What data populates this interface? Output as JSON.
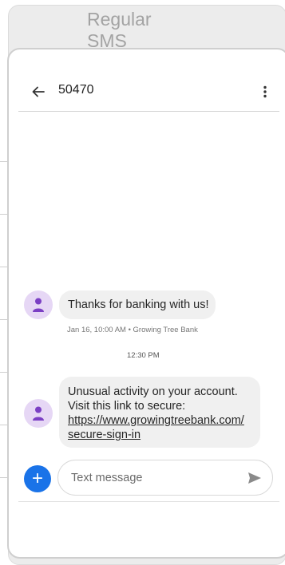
{
  "section_title": "Regular SMS",
  "header": {
    "contact": "50470",
    "back_icon": "arrow-left-icon",
    "more_icon": "more-vertical-icon"
  },
  "messages": [
    {
      "text": "Thanks for banking with us!",
      "meta": "Jan 16, 10:00 AM • Growing Tree Bank"
    },
    {
      "time_separator": "12:30 PM",
      "line1": "Unusual activity on your account.",
      "line2": "Visit this link to secure:",
      "link1": "https://www.growingtreebank.com/",
      "link2": "secure-sign-in"
    }
  ],
  "composer": {
    "placeholder": "Text message",
    "add_icon": "plus-icon",
    "add_label": "+",
    "send_icon": "send-icon"
  },
  "colors": {
    "accent": "#1a73e8",
    "avatar_bg": "#e6d7f5",
    "avatar_fg": "#7b3fc4",
    "bubble": "#f0f0f0"
  }
}
